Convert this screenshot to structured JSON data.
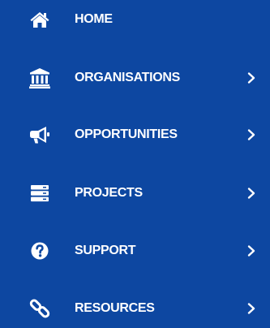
{
  "sidebar": {
    "background_color": "#0d47a1",
    "text_color": "#ffffff",
    "items": [
      {
        "label": "HOME",
        "icon": "home-icon",
        "has_submenu": false
      },
      {
        "label": "ORGANISATIONS",
        "icon": "bank-icon",
        "has_submenu": true
      },
      {
        "label": "OPPORTUNITIES",
        "icon": "megaphone-icon",
        "has_submenu": true
      },
      {
        "label": "PROJECTS",
        "icon": "server-icon",
        "has_submenu": true
      },
      {
        "label": "SUPPORT",
        "icon": "question-circle-icon",
        "has_submenu": true
      },
      {
        "label": "RESOURCES",
        "icon": "link-icon",
        "has_submenu": true
      }
    ]
  }
}
